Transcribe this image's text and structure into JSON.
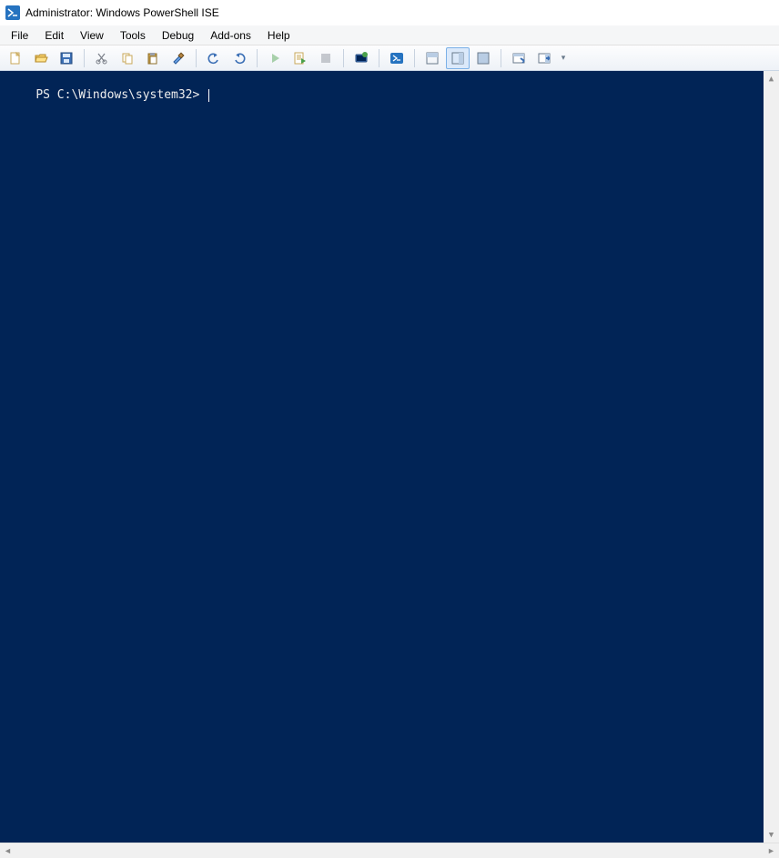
{
  "window": {
    "title": "Administrator: Windows PowerShell ISE"
  },
  "menu": {
    "items": [
      "File",
      "Edit",
      "View",
      "Tools",
      "Debug",
      "Add-ons",
      "Help"
    ]
  },
  "toolbar": {
    "buttons": [
      {
        "name": "new-icon",
        "label": "New"
      },
      {
        "name": "open-icon",
        "label": "Open"
      },
      {
        "name": "save-icon",
        "label": "Save"
      },
      {
        "name": "cut-icon",
        "label": "Cut"
      },
      {
        "name": "copy-icon",
        "label": "Copy"
      },
      {
        "name": "paste-icon",
        "label": "Paste"
      },
      {
        "name": "clear-icon",
        "label": "Clear Console Pane"
      }
    ],
    "undo": "Undo",
    "redo": "Redo",
    "run": "Run Script",
    "run_selection": "Run Selection",
    "stop": "Stop",
    "new_remote": "New Remote PowerShell Tab",
    "start_ps": "Start PowerShell.exe",
    "layout_top": "Show Script Pane Top",
    "layout_right": "Show Script Pane Right",
    "layout_max": "Show Script Pane Maximized",
    "show_command": "Show Command Window",
    "show_addon": "Show Command Add-on"
  },
  "console": {
    "prompt": "PS C:\\Windows\\system32> "
  }
}
